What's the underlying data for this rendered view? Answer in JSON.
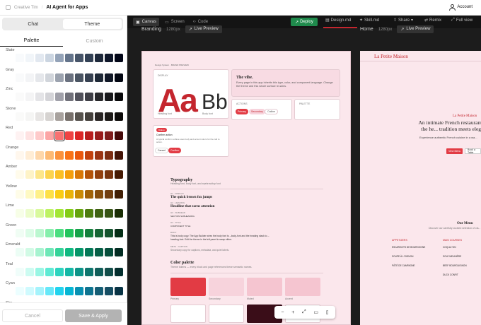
{
  "header": {
    "brand": "Creative Tim",
    "title": "AI Agent for Apps",
    "account": "Account"
  },
  "left": {
    "tabs": [
      {
        "label": "Chat"
      },
      {
        "label": "Theme"
      }
    ],
    "subtabs": [
      {
        "label": "Palette"
      },
      {
        "label": "Custom"
      }
    ],
    "palettes": [
      {
        "name": "Slate",
        "colors": [
          "#f8fafc",
          "#f1f5f9",
          "#e2e8f0",
          "#cbd5e1",
          "#94a3b8",
          "#64748b",
          "#475569",
          "#334155",
          "#1e293b",
          "#0f172a",
          "#020617"
        ]
      },
      {
        "name": "Gray",
        "colors": [
          "#f9fafb",
          "#f3f4f6",
          "#e5e7eb",
          "#d1d5db",
          "#9ca3af",
          "#6b7280",
          "#4b5563",
          "#374151",
          "#1f2937",
          "#111827",
          "#030712"
        ]
      },
      {
        "name": "Zinc",
        "colors": [
          "#fafafa",
          "#f4f4f5",
          "#e4e4e7",
          "#d4d4d8",
          "#a1a1aa",
          "#71717a",
          "#52525b",
          "#3f3f46",
          "#27272a",
          "#18181b",
          "#09090b"
        ]
      },
      {
        "name": "Stone",
        "colors": [
          "#fafaf9",
          "#f5f5f4",
          "#e7e5e4",
          "#d6d3d1",
          "#a8a29e",
          "#78716c",
          "#57534e",
          "#44403c",
          "#292524",
          "#1c1917",
          "#0c0a09"
        ]
      },
      {
        "name": "Red",
        "colors": [
          "#fef2f2",
          "#fee2e2",
          "#fecaca",
          "#fca5a5",
          "#f87171",
          "#ef4444",
          "#dc2626",
          "#b91c1c",
          "#991b1b",
          "#7f1d1d",
          "#450a0a"
        ],
        "selected": 4
      },
      {
        "name": "Orange",
        "colors": [
          "#fff7ed",
          "#ffedd5",
          "#fed7aa",
          "#fdba74",
          "#fb923c",
          "#f97316",
          "#ea580c",
          "#c2410c",
          "#9a3412",
          "#7c2d12",
          "#431407"
        ]
      },
      {
        "name": "Amber",
        "colors": [
          "#fffbeb",
          "#fef3c7",
          "#fde68a",
          "#fcd34d",
          "#fbbf24",
          "#f59e0b",
          "#d97706",
          "#b45309",
          "#92400e",
          "#78350f",
          "#451a03"
        ]
      },
      {
        "name": "Yellow",
        "colors": [
          "#fefce8",
          "#fef9c3",
          "#fef08a",
          "#fde047",
          "#facc15",
          "#eab308",
          "#ca8a04",
          "#a16207",
          "#854d0e",
          "#713f12",
          "#422006"
        ]
      },
      {
        "name": "Lime",
        "colors": [
          "#f7fee7",
          "#ecfccb",
          "#d9f99d",
          "#bef264",
          "#a3e635",
          "#84cc16",
          "#65a30d",
          "#4d7c0f",
          "#3f6212",
          "#365314",
          "#1a2e05"
        ]
      },
      {
        "name": "Green",
        "colors": [
          "#f0fdf4",
          "#dcfce7",
          "#bbf7d0",
          "#86efac",
          "#4ade80",
          "#22c55e",
          "#16a34a",
          "#15803d",
          "#166534",
          "#14532d",
          "#052e16"
        ]
      },
      {
        "name": "Emerald",
        "colors": [
          "#ecfdf5",
          "#d1fae5",
          "#a7f3d0",
          "#6ee7b7",
          "#34d399",
          "#10b981",
          "#059669",
          "#047857",
          "#065f46",
          "#064e3b",
          "#022c22"
        ]
      },
      {
        "name": "Teal",
        "colors": [
          "#f0fdfa",
          "#ccfbf1",
          "#99f6e4",
          "#5eead4",
          "#2dd4bf",
          "#14b8a6",
          "#0d9488",
          "#0f766e",
          "#115e59",
          "#134e4a",
          "#042f2e"
        ]
      },
      {
        "name": "Cyan",
        "colors": [
          "#ecfeff",
          "#cffafe",
          "#a5f3fc",
          "#67e8f9",
          "#22d3ee",
          "#06b6d4",
          "#0891b2",
          "#0e7490",
          "#155e75",
          "#164e63",
          "#083344"
        ]
      },
      {
        "name": "Sky",
        "colors": [
          "#f0f9ff",
          "#e0f2fe",
          "#bae6fd",
          "#7dd3fc",
          "#38bdf8",
          "#0ea5e9",
          "#0284c7",
          "#0369a1",
          "#075985",
          "#0c4a6e",
          "#082f49"
        ]
      }
    ],
    "cancel": "Cancel",
    "save": "Save & Apply"
  },
  "toolbar": {
    "canvas": "Canvas",
    "screen": "Screen",
    "code": "Code",
    "deploy": "Deploy",
    "designmd": "Design.md",
    "skillmd": "Skill.md",
    "share": "Share",
    "remix": "Remix",
    "fullview": "Full view"
  },
  "branding": {
    "label": "Branding",
    "size": "1280px",
    "live": "Live Preview",
    "top": "Design System · BRAND PREVIEW",
    "display": "DISPLAY",
    "aa": "Aa",
    "bb": "Bb",
    "heading_font": "Heading font",
    "body_font": "Body font",
    "vibe_title": "The vibe.",
    "vibe_text": "Every page in this app inherits this type, color, and component language. Change the theme and this whole surface re-skins.",
    "actions": "ACTIONS",
    "primary": "Primary",
    "secondary": "Secondary",
    "outline": "Outline",
    "palette": "PALETTE",
    "dialog_badge": "Dialog",
    "dialog_title": "Confirm action",
    "dialog_text": "A typical confirm surface uses body and accent colors for the call to action.",
    "cancel": "Cancel",
    "confirm": "Confirm",
    "typo_title": "Typography",
    "typo_sub": "Heading font, body font, and eyebrow/top font",
    "t1_lbl": "H1 · DISPLAY",
    "t1": "The quick brown fox jumps",
    "t2_lbl": "H2 · HEADING",
    "t2": "Headline that earns attention",
    "t3_lbl": "H3 · SUBHEAD",
    "t3": "SECTION SUBHEADING",
    "t4_lbl": "H4 · TITLE",
    "t4": "COMPONENT TITLE",
    "t5_lbl": "BODY",
    "t5": "This is body copy. The App Builder wires the body font to --body-font and the heading stack to --heading-font. Edit the theme in the left panel to swap either.",
    "t6_lbl": "META · CAPTION",
    "t6": "Secondary copy for captions, metadata, and quiet labels.",
    "color_title": "Color palette",
    "color_sub": "Theme tokens — every block and page references these semantic names.",
    "color_names": [
      "Primary",
      "Secondary",
      "Muted",
      "Accent"
    ],
    "colors": [
      "#e23b44",
      "#f7d3dc",
      "#f5c5d0",
      "#f5c5d0",
      "#ffffff",
      "#ffffff",
      "#3a0d18",
      "#ffffff"
    ]
  },
  "home": {
    "label": "Home",
    "size": "1280px",
    "live": "Live Preview",
    "brand": "La Petite Maison",
    "hero_small": "La Petite Maison",
    "hero": "An intimate French restaurant in the he... tradition meets elega...",
    "hero_sub": "Experience authentic French cuisine in a wa...",
    "btn1": "View Menu",
    "btn2": "Book a Table",
    "menu_title": "Our Menu",
    "menu_sub": "Discover our carefully curated selection of cla...",
    "appetizers": "APPETIZERS",
    "main": "MAIN COURSES",
    "items_a": [
      "ESCARGOTS DE BOURGOGNE",
      "SOUPE À L'OIGNON",
      "PÂTÉ DE CAMPAGNE"
    ],
    "items_b": [
      "COQ AU VIN",
      "SOLE MEUNIÈRE",
      "BEEF BOURGUIGNON",
      "DUCK CONFIT"
    ]
  },
  "zoom": {
    "out": "−",
    "in": "+",
    "fit": "⤢",
    "desktop": "▭",
    "mobile": "▯"
  }
}
